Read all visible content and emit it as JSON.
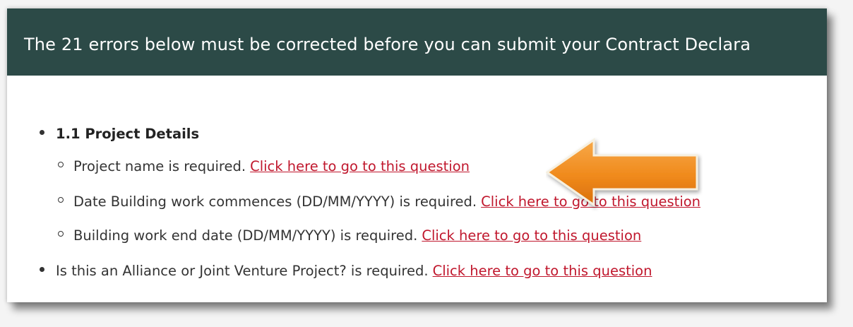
{
  "banner": {
    "text": "The 21 errors below must be corrected before you can submit your Contract Declara"
  },
  "errors": {
    "section": {
      "title": "1.1 Project Details",
      "items": [
        {
          "message": "Project name is required.",
          "link": "Click here to go to this question"
        },
        {
          "message": "Date Building work commences (DD/MM/YYYY) is required.",
          "link": "Click here to go to this question"
        },
        {
          "message": "Building work end date (DD/MM/YYYY) is required.",
          "link": "Click here to go to this question"
        }
      ]
    },
    "top_level_items": [
      {
        "message": "Is this an Alliance or Joint Venture Project? is required.",
        "link": "Click here to go to this question"
      }
    ]
  },
  "colors": {
    "header_bg": "#2c4a47",
    "link": "#c0172d",
    "arrow": "#f28c1a"
  },
  "annotation_icon": "orange-arrow-icon"
}
